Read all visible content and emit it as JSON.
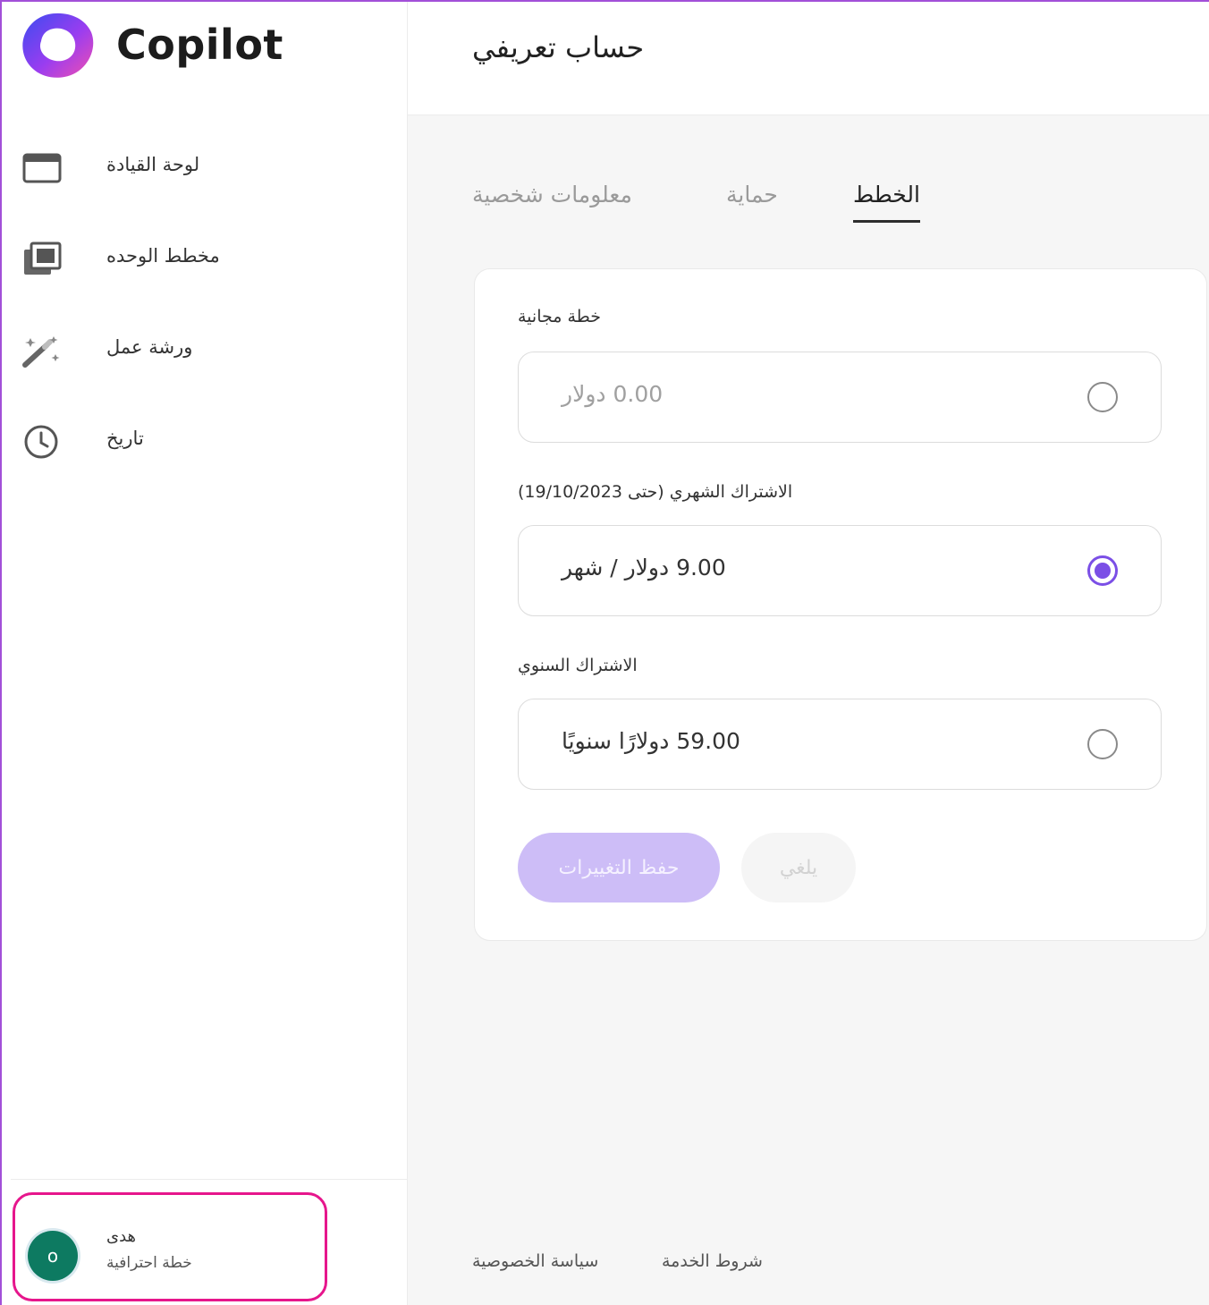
{
  "app": {
    "name": "Copilot"
  },
  "sidebar": {
    "items": [
      {
        "label": "لوحة القيادة",
        "icon": "dashboard-window-icon"
      },
      {
        "label": "مخطط الوحده",
        "icon": "unit-layers-icon"
      },
      {
        "label": "ورشة عمل",
        "icon": "magic-wand-icon"
      },
      {
        "label": "تاريخ",
        "icon": "clock-icon"
      }
    ]
  },
  "user": {
    "initial": "o",
    "name": "هدى",
    "plan": "خطة احترافية"
  },
  "header": {
    "title": "حساب تعريفي"
  },
  "tabs": {
    "plans": "الخطط",
    "security": "حماية",
    "personal": "معلومات شخصية"
  },
  "plans": {
    "free": {
      "label": "خطة مجانية",
      "price": "0.00 دولار"
    },
    "monthly": {
      "label": "الاشتراك الشهري (حتى 19/10/2023)",
      "price": "9.00 دولار / شهر"
    },
    "annual": {
      "label": "الاشتراك السنوي",
      "price": "59.00 دولارًا سنويًا"
    },
    "selected": "monthly"
  },
  "buttons": {
    "save": "حفظ التغييرات",
    "cancel": "يلغي"
  },
  "footer": {
    "terms": "شروط الخدمة",
    "privacy": "سياسة الخصوصية"
  },
  "colors": {
    "accent": "#7b4fe6",
    "avatar": "#0d7a61",
    "highlight": "#e6168c"
  }
}
